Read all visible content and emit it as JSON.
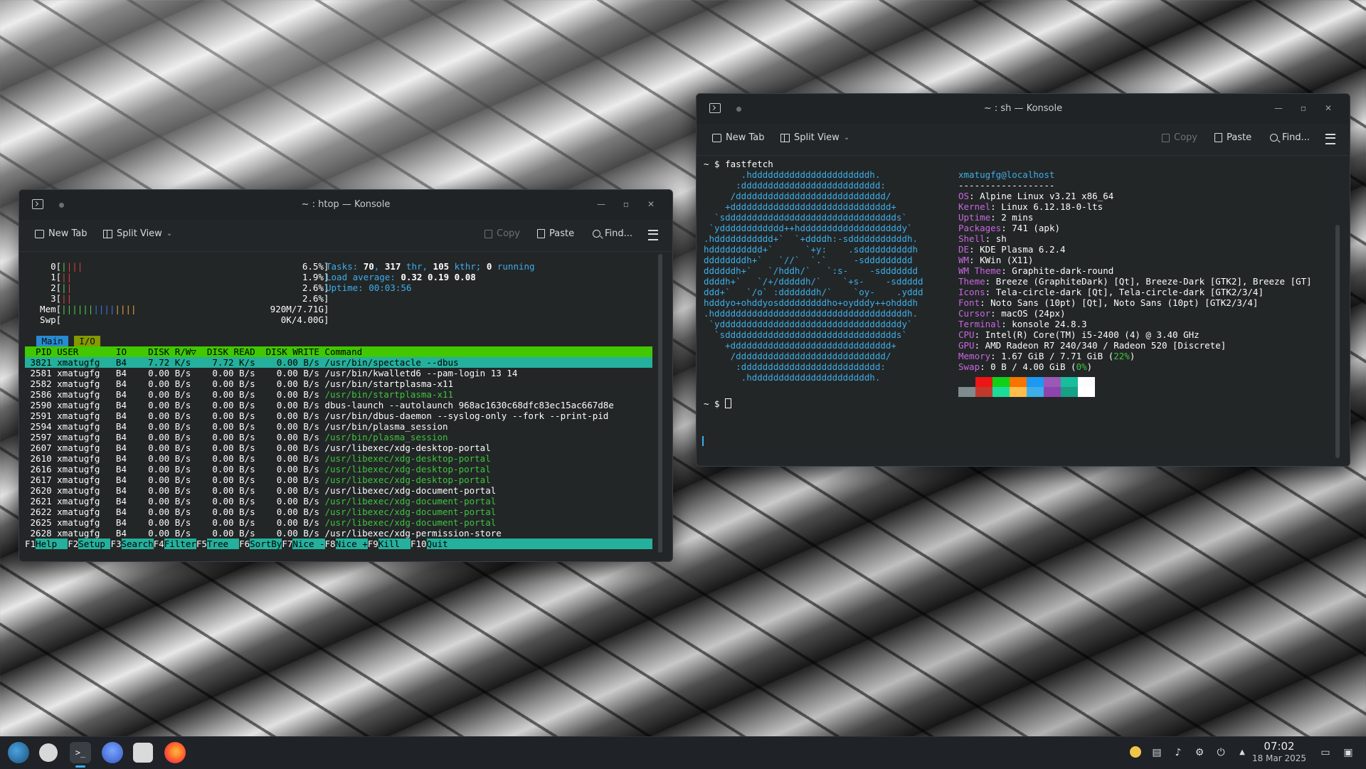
{
  "windows": {
    "htop": {
      "title": "~ : htop — Konsole",
      "toolbar": {
        "new_tab": "New Tab",
        "split_view": "Split View",
        "copy": "Copy",
        "paste": "Paste",
        "find": "Find..."
      },
      "meters_left": [
        "    0[",
        "    1[",
        "    2[",
        "    3[",
        "  Mem[",
        "  Swp["
      ],
      "meters_right": [
        "6.5%]",
        "1.9%]",
        "2.6%]",
        "2.6%]",
        "920M/7.71G]",
        "0K/4.00G]"
      ],
      "tasks_line": "Tasks: 70, 317 thr, 105 kthr; 0 running",
      "load_line": "Load average: 0.32 0.19 0.08",
      "uptime_line": "Uptime: 00:03:56",
      "tab_main": "Main",
      "tab_io": "I/O",
      "header": "  PID USER       IO    DISK R/W▽  DISK READ  DISK WRITE Command",
      "processes": [
        {
          "row": " 3821 xmatugfg   B4    7.72 K/s    7.72 K/s    0.00 B/s ",
          "cmd": "/usr/bin/spectacle --dbus",
          "green": false
        },
        {
          "row": " 2581 xmatugfg   B4    0.00 B/s    0.00 B/s    0.00 B/s ",
          "cmd": "/usr/bin/kwalletd6 --pam-login 13 14",
          "green": false
        },
        {
          "row": " 2582 xmatugfg   B4    0.00 B/s    0.00 B/s    0.00 B/s ",
          "cmd": "/usr/bin/startplasma-x11",
          "green": false
        },
        {
          "row": " 2586 xmatugfg   B4    0.00 B/s    0.00 B/s    0.00 B/s ",
          "cmd": "/usr/bin/startplasma-x11",
          "green": true
        },
        {
          "row": " 2590 xmatugfg   B4    0.00 B/s    0.00 B/s    0.00 B/s ",
          "cmd": "dbus-launch --autolaunch 968ac1630c68dfc83ec15ac667d8e",
          "green": false
        },
        {
          "row": " 2591 xmatugfg   B4    0.00 B/s    0.00 B/s    0.00 B/s ",
          "cmd": "/usr/bin/dbus-daemon --syslog-only --fork --print-pid",
          "green": false
        },
        {
          "row": " 2594 xmatugfg   B4    0.00 B/s    0.00 B/s    0.00 B/s ",
          "cmd": "/usr/bin/plasma_session",
          "green": false
        },
        {
          "row": " 2597 xmatugfg   B4    0.00 B/s    0.00 B/s    0.00 B/s ",
          "cmd": "/usr/bin/plasma_session",
          "green": true
        },
        {
          "row": " 2607 xmatugfg   B4    0.00 B/s    0.00 B/s    0.00 B/s ",
          "cmd": "/usr/libexec/xdg-desktop-portal",
          "green": false
        },
        {
          "row": " 2610 xmatugfg   B4    0.00 B/s    0.00 B/s    0.00 B/s ",
          "cmd": "/usr/libexec/xdg-desktop-portal",
          "green": true
        },
        {
          "row": " 2616 xmatugfg   B4    0.00 B/s    0.00 B/s    0.00 B/s ",
          "cmd": "/usr/libexec/xdg-desktop-portal",
          "green": true
        },
        {
          "row": " 2617 xmatugfg   B4    0.00 B/s    0.00 B/s    0.00 B/s ",
          "cmd": "/usr/libexec/xdg-desktop-portal",
          "green": true
        },
        {
          "row": " 2620 xmatugfg   B4    0.00 B/s    0.00 B/s    0.00 B/s ",
          "cmd": "/usr/libexec/xdg-document-portal",
          "green": false
        },
        {
          "row": " 2621 xmatugfg   B4    0.00 B/s    0.00 B/s    0.00 B/s ",
          "cmd": "/usr/libexec/xdg-document-portal",
          "green": true
        },
        {
          "row": " 2622 xmatugfg   B4    0.00 B/s    0.00 B/s    0.00 B/s ",
          "cmd": "/usr/libexec/xdg-document-portal",
          "green": true
        },
        {
          "row": " 2625 xmatugfg   B4    0.00 B/s    0.00 B/s    0.00 B/s ",
          "cmd": "/usr/libexec/xdg-document-portal",
          "green": true
        },
        {
          "row": " 2628 xmatugfg   B4    0.00 B/s    0.00 B/s    0.00 B/s ",
          "cmd": "/usr/libexec/xdg-permission-store",
          "green": false
        }
      ],
      "fkeys": [
        {
          "key": "F1",
          "label": "Help  "
        },
        {
          "key": "F2",
          "label": "Setup "
        },
        {
          "key": "F3",
          "label": "Search"
        },
        {
          "key": "F4",
          "label": "Filter"
        },
        {
          "key": "F5",
          "label": "Tree  "
        },
        {
          "key": "F6",
          "label": "SortBy"
        },
        {
          "key": "F7",
          "label": "Nice -"
        },
        {
          "key": "F8",
          "label": "Nice +"
        },
        {
          "key": "F9",
          "label": "Kill  "
        },
        {
          "key": "F10",
          "label": "Quit                                   "
        }
      ]
    },
    "sh": {
      "title": "~ : sh — Konsole",
      "toolbar": {
        "new_tab": "New Tab",
        "split_view": "Split View",
        "copy": "Copy",
        "paste": "Paste",
        "find": "Find..."
      },
      "command_line": "~ $ fastfetch",
      "prompt": "~ $ ",
      "logo": [
        "       .hddddddddddddddddddddddh.",
        "      :dddddddddddddddddddddddddd:",
        "     /dddddddddddddddddddddddddddd/",
        "    +dddddddddddddddddddddddddddddd+",
        "  `sdddddddddddddddddddddddddddddddds`",
        " `ydddddddddddd++hdddddddddddddddddddy`",
        ".hddddddddddd+`  `+ddddh:-sdddddddddddh.",
        "hdddddddddd+`      `+y:    .sddddddddddh",
        "ddddddddh+`   `//`  `.`     -sddddddddd",
        "ddddddh+`   `/hddh/`   `:s-    -sddddddd",
        "ddddh+`   `/+/dddddh/`    `+s-    -sddddd",
        "ddd+`   `/o` :dddddddh/`    `oy-    .yddd",
        "hdddyo+ohddyosdddddddddho+oydddy++ohdddh",
        ".hddddddddddddddddddddddddddddddddddddh.",
        " `yddddddddddddddddddddddddddddddddddy`",
        "  `sdddddddddddddddddddddddddddddddds`",
        "    +dddddddddddddddddddddddddddddd+",
        "     /dddddddddddddddddddddddddddd/",
        "      :dddddddddddddddddddddddddd:",
        "       .hddddddddddddddddddddddh."
      ],
      "user_host": "xmatugfg@localhost",
      "separator": "------------------",
      "info": [
        {
          "key": "OS",
          "value": "Alpine Linux v3.21 x86_64"
        },
        {
          "key": "Kernel",
          "value": "Linux 6.12.18-0-lts"
        },
        {
          "key": "Uptime",
          "value": "2 mins"
        },
        {
          "key": "Packages",
          "value": "741 (apk)"
        },
        {
          "key": "Shell",
          "value": "sh"
        },
        {
          "key": "DE",
          "value": "KDE Plasma 6.2.4"
        },
        {
          "key": "WM",
          "value": "KWin (X11)"
        },
        {
          "key": "WM Theme",
          "value": "Graphite-dark-round"
        },
        {
          "key": "Theme",
          "value": "Breeze (GraphiteDark) [Qt], Breeze-Dark [GTK2], Breeze [GT]"
        },
        {
          "key": "Icons",
          "value": "Tela-circle-dark [Qt], Tela-circle-dark [GTK2/3/4]"
        },
        {
          "key": "Font",
          "value": "Noto Sans (10pt) [Qt], Noto Sans (10pt) [GTK2/3/4]"
        },
        {
          "key": "Cursor",
          "value": "macOS (24px)"
        },
        {
          "key": "Terminal",
          "value": "konsole 24.8.3"
        },
        {
          "key": "CPU",
          "value": "Intel(R) Core(TM) i5-2400 (4) @ 3.40 GHz"
        },
        {
          "key": "GPU",
          "value": "AMD Radeon R7 240/340 / Radeon 520 [Discrete]"
        },
        {
          "key": "Memory",
          "value": "1.67 GiB / 7.71 GiB (",
          "pct": "22%",
          "tail": ")"
        },
        {
          "key": "Swap",
          "value": "0 B / 4.00 GiB (",
          "pct": "0%",
          "tail": ")"
        }
      ],
      "palette_top": [
        "#232627",
        "#ed1515",
        "#11d116",
        "#f67400",
        "#1d99f3",
        "#9b59b6",
        "#1abc9c",
        "#fcfcfc"
      ],
      "palette_bottom": [
        "#7f8c8d",
        "#c0392b",
        "#1cdc9a",
        "#fdbc4b",
        "#3daee9",
        "#8e44ad",
        "#16a085",
        "#ffffff"
      ]
    }
  },
  "taskbar": {
    "apps": [
      "application-launcher",
      "system-settings",
      "konsole",
      "discover",
      "dolphin",
      "firefox"
    ],
    "clock_time": "07:02",
    "clock_date": "18 Mar 2025"
  }
}
